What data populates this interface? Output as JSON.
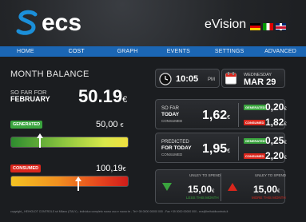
{
  "header": {
    "logo_text": "ecs",
    "product": "eVision",
    "flags": [
      "flag-de-icon",
      "flag-it-icon",
      "flag-uk-icon"
    ]
  },
  "nav": {
    "items": [
      {
        "label": "HOME"
      },
      {
        "label": "COST"
      },
      {
        "label": "GRAPH"
      },
      {
        "label": "EVENTS"
      },
      {
        "label": "SETTINGS"
      },
      {
        "label": "ADVANCED"
      }
    ],
    "active": "COST"
  },
  "balance": {
    "title": "MONTH BALANCE",
    "so_far_line1": "SO FAR FOR",
    "so_far_line2": "FEBRUARY",
    "value": "50.19",
    "currency": "€"
  },
  "generated": {
    "badge": "GENERATED",
    "value": "50,00",
    "currency": "€"
  },
  "consumed": {
    "badge": "CONSUMED",
    "value": "100,19",
    "currency": "€"
  },
  "clock": {
    "time": "10:05",
    "ampm": "PM",
    "weekday": "WEDNESDAY",
    "date": "MAR 29"
  },
  "today": {
    "line1": "SO FAR",
    "line2": "TODAY",
    "sub": "CONSUMED",
    "value": "1,62",
    "currency": "€",
    "generated_badge": "GENERATED",
    "generated_value": "0,20",
    "consumed_badge": "CONSUMED",
    "consumed_value": "1,82"
  },
  "predicted": {
    "line1": "PREDICTED",
    "line2": "FOR TODAY",
    "sub": "CONSUMED",
    "value": "1,95",
    "currency": "€",
    "generated_badge": "GENERATED",
    "generated_value": "0,25",
    "consumed_badge": "CONSUMED",
    "consumed_value": "2,20"
  },
  "spend": {
    "left_caption": "UNLEY TO SPEND",
    "left_value": "15,00",
    "left_note": "LESS THIS MONTH",
    "right_caption": "UNLEY TO SPEND",
    "right_value": "15,00",
    "right_note": "MORE THIS MONTH",
    "currency": "€"
  },
  "footer": {
    "text": "copyright_ HEIHOLDT CONTROLS srl  Milano (ITALY) - individuo completo nuovo uso e nuovo te - Tel +39 0000 00000 000 - Fax +39 0000 00000 000 - ecs@heiholdtcontrols.it"
  },
  "colors": {
    "accent_blue": "#1b66b4",
    "green": "#3aa43e",
    "red": "#d9261c"
  }
}
